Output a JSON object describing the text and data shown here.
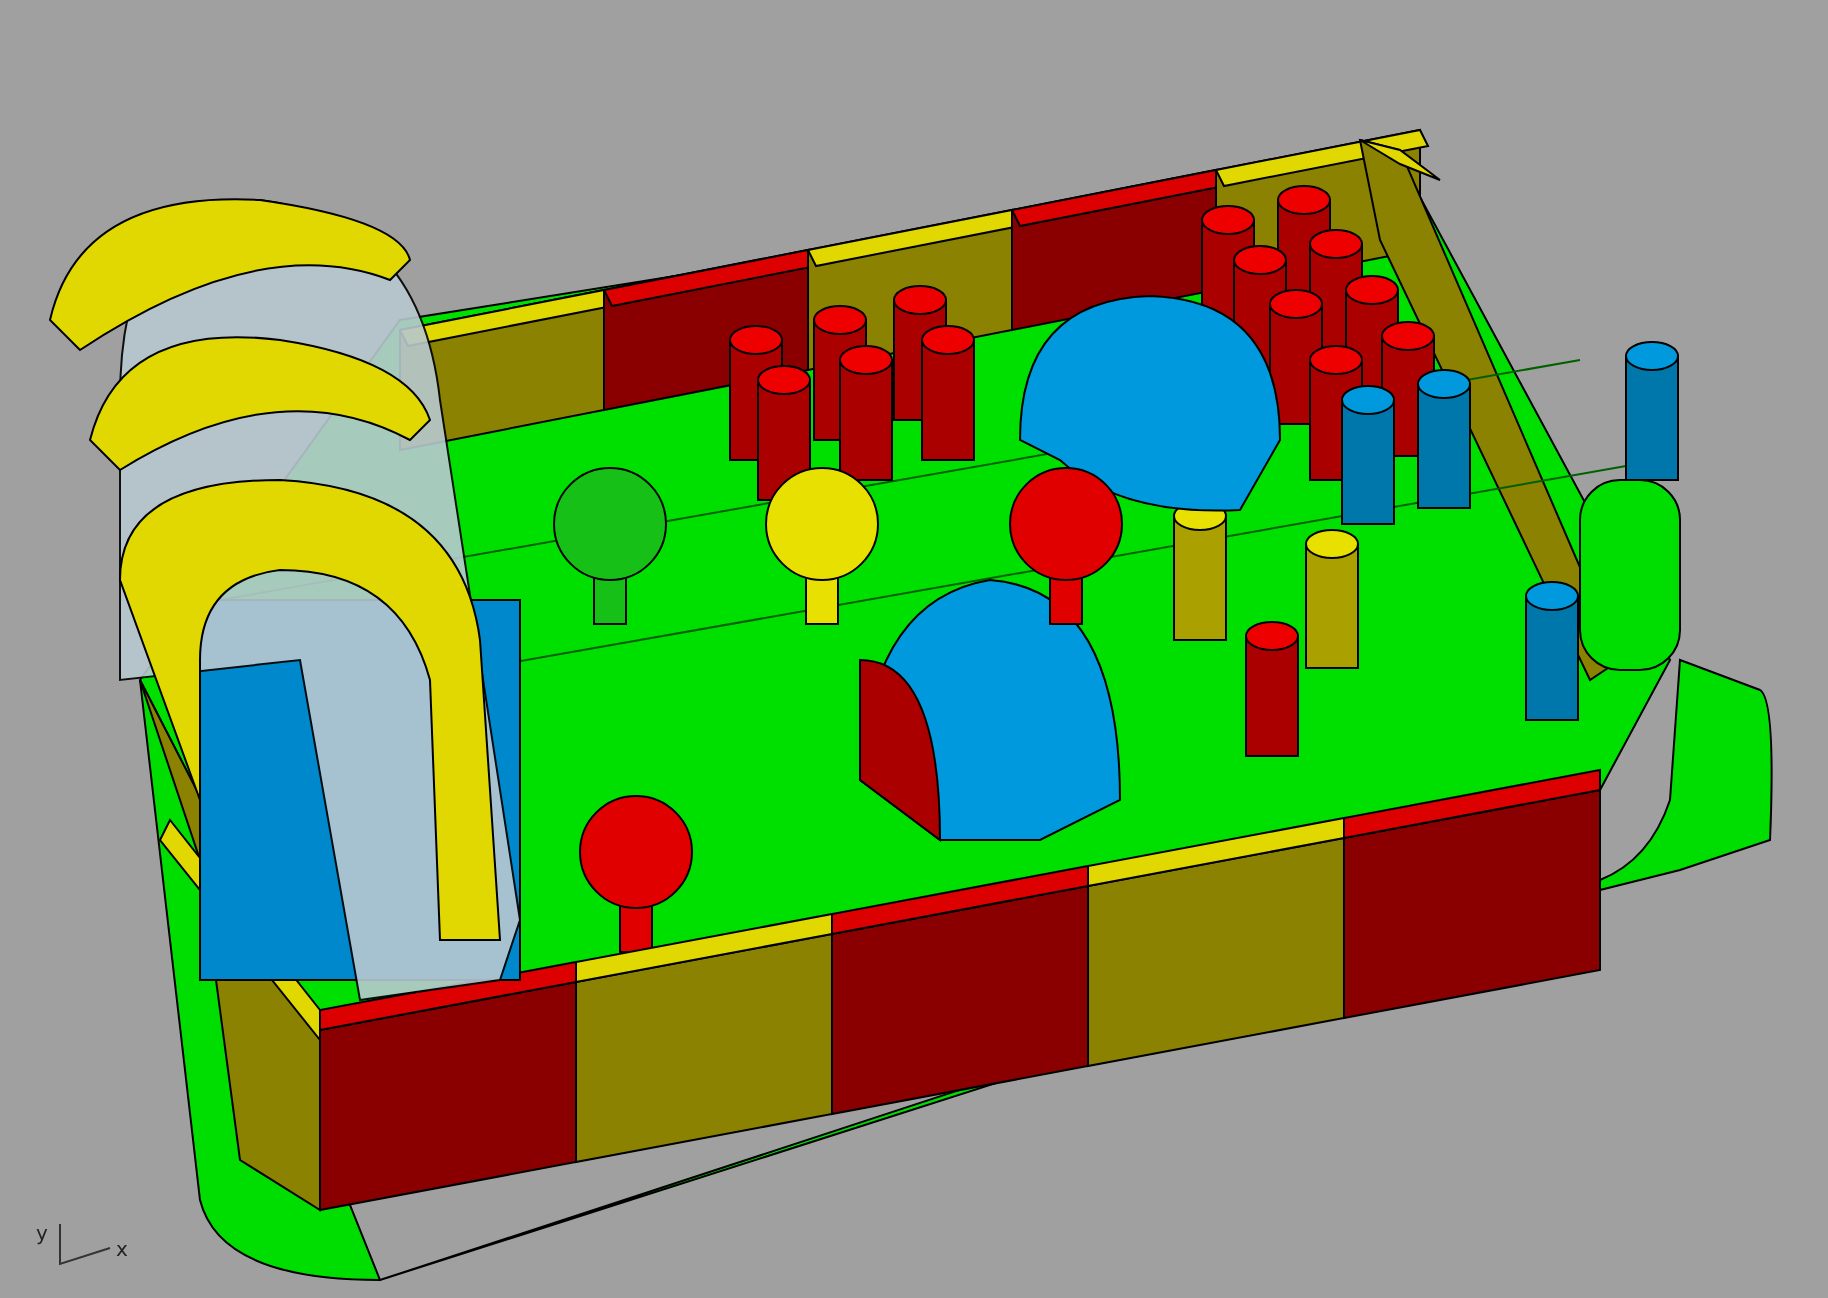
{
  "viewport": {
    "axis_labels": {
      "y": "y",
      "x": "x"
    }
  }
}
